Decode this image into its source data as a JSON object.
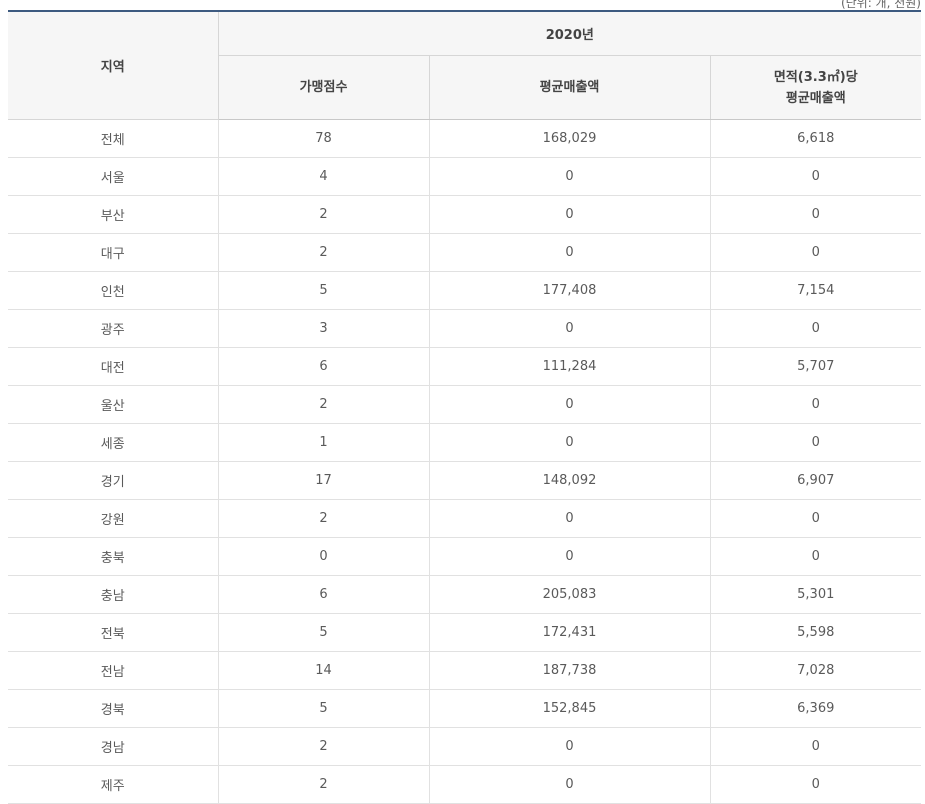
{
  "unit_note": "(단위: 개, 천원)",
  "header": {
    "region": "지역",
    "year": "2020년",
    "stores": "가맹점수",
    "avg_sales": "평균매출액",
    "area_line1": "면적(3.3㎡)당",
    "area_line2": "평균매출액"
  },
  "rows": [
    {
      "region": "전체",
      "stores": "78",
      "avg_sales": "168,029",
      "area_sales": "6,618"
    },
    {
      "region": "서울",
      "stores": "4",
      "avg_sales": "0",
      "area_sales": "0"
    },
    {
      "region": "부산",
      "stores": "2",
      "avg_sales": "0",
      "area_sales": "0"
    },
    {
      "region": "대구",
      "stores": "2",
      "avg_sales": "0",
      "area_sales": "0"
    },
    {
      "region": "인천",
      "stores": "5",
      "avg_sales": "177,408",
      "area_sales": "7,154"
    },
    {
      "region": "광주",
      "stores": "3",
      "avg_sales": "0",
      "area_sales": "0"
    },
    {
      "region": "대전",
      "stores": "6",
      "avg_sales": "111,284",
      "area_sales": "5,707"
    },
    {
      "region": "울산",
      "stores": "2",
      "avg_sales": "0",
      "area_sales": "0"
    },
    {
      "region": "세종",
      "stores": "1",
      "avg_sales": "0",
      "area_sales": "0"
    },
    {
      "region": "경기",
      "stores": "17",
      "avg_sales": "148,092",
      "area_sales": "6,907"
    },
    {
      "region": "강원",
      "stores": "2",
      "avg_sales": "0",
      "area_sales": "0"
    },
    {
      "region": "충북",
      "stores": "0",
      "avg_sales": "0",
      "area_sales": "0"
    },
    {
      "region": "충남",
      "stores": "6",
      "avg_sales": "205,083",
      "area_sales": "5,301"
    },
    {
      "region": "전북",
      "stores": "5",
      "avg_sales": "172,431",
      "area_sales": "5,598"
    },
    {
      "region": "전남",
      "stores": "14",
      "avg_sales": "187,738",
      "area_sales": "7,028"
    },
    {
      "region": "경북",
      "stores": "5",
      "avg_sales": "152,845",
      "area_sales": "6,369"
    },
    {
      "region": "경남",
      "stores": "2",
      "avg_sales": "0",
      "area_sales": "0"
    },
    {
      "region": "제주",
      "stores": "2",
      "avg_sales": "0",
      "area_sales": "0"
    }
  ]
}
